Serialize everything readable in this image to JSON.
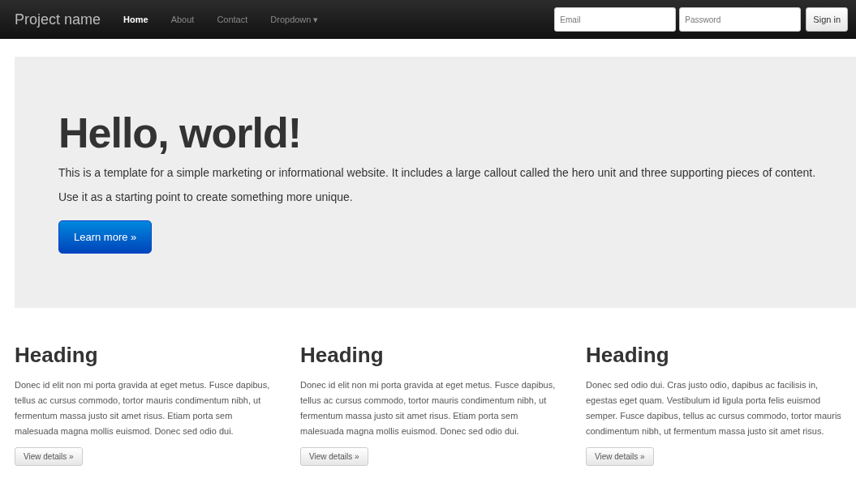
{
  "navbar": {
    "brand": "Project name",
    "items": [
      {
        "label": "Home",
        "selected": true
      },
      {
        "label": "About",
        "selected": false
      },
      {
        "label": "Contact",
        "selected": false
      },
      {
        "label": "Dropdown ▾",
        "selected": false
      }
    ],
    "email": {
      "placeholder": "Email"
    },
    "password": {
      "placeholder": "Password"
    },
    "sign_in": "Sign in"
  },
  "hero": {
    "title": "Hello, world!",
    "text": "This is a template for a simple marketing or informational website. It includes a large callout called the hero unit and three supporting pieces of content. Use it as a starting point to create something more unique.",
    "button": "Learn more »"
  },
  "columns": [
    {
      "heading": "Heading",
      "text": "Donec id elit non mi porta gravida at eget metus. Fusce dapibus, tellus ac cursus commodo, tortor mauris condimentum nibh, ut fermentum massa justo sit amet risus. Etiam porta sem malesuada magna mollis euismod. Donec sed odio dui.",
      "button": "View details »"
    },
    {
      "heading": "Heading",
      "text": "Donec id elit non mi porta gravida at eget metus. Fusce dapibus, tellus ac cursus commodo, tortor mauris condimentum nibh, ut fermentum massa justo sit amet risus. Etiam porta sem malesuada magna mollis euismod. Donec sed odio dui.",
      "button": "View details »"
    },
    {
      "heading": "Heading",
      "text": "Donec sed odio dui. Cras justo odio, dapibus ac facilisis in, egestas eget quam. Vestibulum id ligula porta felis euismod semper. Fusce dapibus, tellus ac cursus commodo, tortor mauris condimentum nibh, ut fermentum massa justo sit amet risus.",
      "button": "View details »"
    }
  ]
}
